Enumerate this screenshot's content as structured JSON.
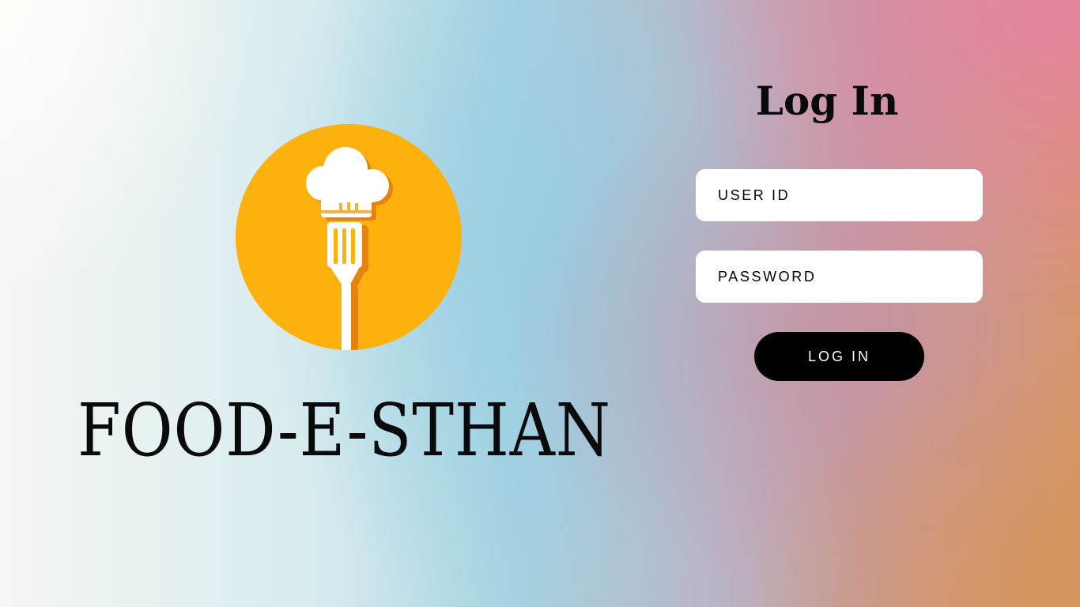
{
  "brand": {
    "name": "FOOD-E-STHAN",
    "logo_icon": "chef-hat-fork-icon",
    "logo_color": "#fdb10c"
  },
  "login": {
    "title": "Log In",
    "user_id_placeholder": "USER ID",
    "password_placeholder": "PASSWORD",
    "button_label": "LOG IN"
  }
}
